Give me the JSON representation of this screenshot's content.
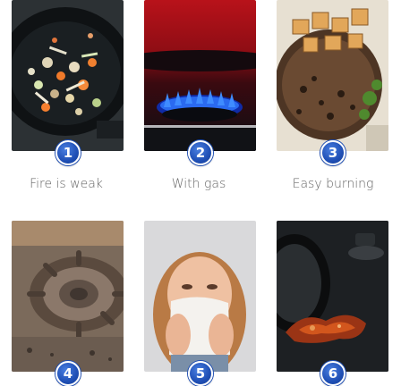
{
  "items": [
    {
      "number": "1",
      "caption": "Fire is weak",
      "image": "wok-stir-fry-vegetables"
    },
    {
      "number": "2",
      "caption": "With gas",
      "image": "gas-burner-blue-flame"
    },
    {
      "number": "3",
      "caption": "Easy burning",
      "image": "grilled-meat-potatoes"
    },
    {
      "number": "4",
      "caption": "",
      "image": "rusty-gas-stove-burner"
    },
    {
      "number": "5",
      "caption": "",
      "image": "woman-covering-nose"
    },
    {
      "number": "6",
      "caption": "",
      "image": "burnt-stain-on-stovetop"
    }
  ],
  "colors": {
    "badge": "#1f4fb5",
    "caption_text": "#666666",
    "background": "#ffffff"
  }
}
